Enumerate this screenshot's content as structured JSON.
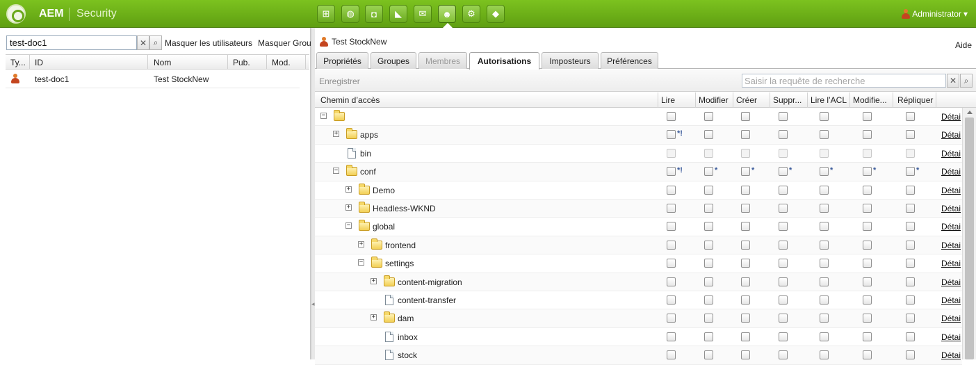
{
  "header": {
    "brand": "AEM",
    "section": "Security",
    "user": "Administrator",
    "user_caret": "▾",
    "tools": [
      "sitemap-icon",
      "globe-icon",
      "camera-icon",
      "megaphone-icon",
      "mail-icon",
      "users-icon",
      "gear-icon",
      "tag-icon"
    ],
    "active_tool": "users-icon"
  },
  "left": {
    "search_value": "test-doc1",
    "clear_glyph": "✕",
    "search_glyph": "⌕",
    "hide_users": "Masquer les utilisateurs",
    "hide_groups": "Masquer Grou",
    "columns": [
      "Ty...",
      "ID",
      "Nom",
      "Pub.",
      "Mod."
    ],
    "rows": [
      {
        "id": "test-doc1",
        "name": "Test StockNew",
        "type_icon": "user-icon"
      }
    ]
  },
  "right": {
    "title": "Test StockNew",
    "help": "Aide",
    "tabs": [
      "Propriétés",
      "Groupes",
      "Membres",
      "Autorisations",
      "Imposteurs",
      "Préférences"
    ],
    "active_tab": "Autorisations",
    "disabled_tab": "Membres",
    "save": "Enregistrer",
    "query_placeholder": "Saisir la requête de recherche",
    "clear_glyph": "✕",
    "search_glyph": "⌕",
    "columns": [
      "Chemin d’accès",
      "Lire",
      "Modifier",
      "Créer",
      "Suppr...",
      "Lire l’ACL",
      "Modifie...",
      "Répliquer"
    ],
    "detail_label": "Détai",
    "rows": [
      {
        "name": "",
        "depth": 0,
        "type": "folder",
        "toggle": "⊟",
        "flags": []
      },
      {
        "name": "apps",
        "depth": 1,
        "type": "folder",
        "toggle": "⊞",
        "flags": [
          "*!"
        ]
      },
      {
        "name": "bin",
        "depth": 1,
        "type": "page",
        "toggle": "",
        "flags": [],
        "disabled": true
      },
      {
        "name": "conf",
        "depth": 1,
        "type": "folder",
        "toggle": "⊟",
        "flags": [
          "*!",
          "*",
          "*",
          "*",
          "*",
          "*",
          "*"
        ]
      },
      {
        "name": "Demo",
        "depth": 2,
        "type": "folder",
        "toggle": "⊞",
        "flags": []
      },
      {
        "name": "Headless-WKND",
        "depth": 2,
        "type": "folder",
        "toggle": "⊞",
        "flags": []
      },
      {
        "name": "global",
        "depth": 2,
        "type": "folder",
        "toggle": "⊟",
        "flags": []
      },
      {
        "name": "frontend",
        "depth": 3,
        "type": "folder",
        "toggle": "⊞",
        "flags": []
      },
      {
        "name": "settings",
        "depth": 3,
        "type": "folder",
        "toggle": "⊟",
        "flags": []
      },
      {
        "name": "content-migration",
        "depth": 4,
        "type": "folder",
        "toggle": "⊞",
        "flags": []
      },
      {
        "name": "content-transfer",
        "depth": 4,
        "type": "page",
        "toggle": "",
        "flags": []
      },
      {
        "name": "dam",
        "depth": 4,
        "type": "folder",
        "toggle": "⊞",
        "flags": []
      },
      {
        "name": "inbox",
        "depth": 4,
        "type": "page",
        "toggle": "",
        "flags": []
      },
      {
        "name": "stock",
        "depth": 4,
        "type": "page",
        "toggle": "",
        "flags": []
      }
    ]
  }
}
